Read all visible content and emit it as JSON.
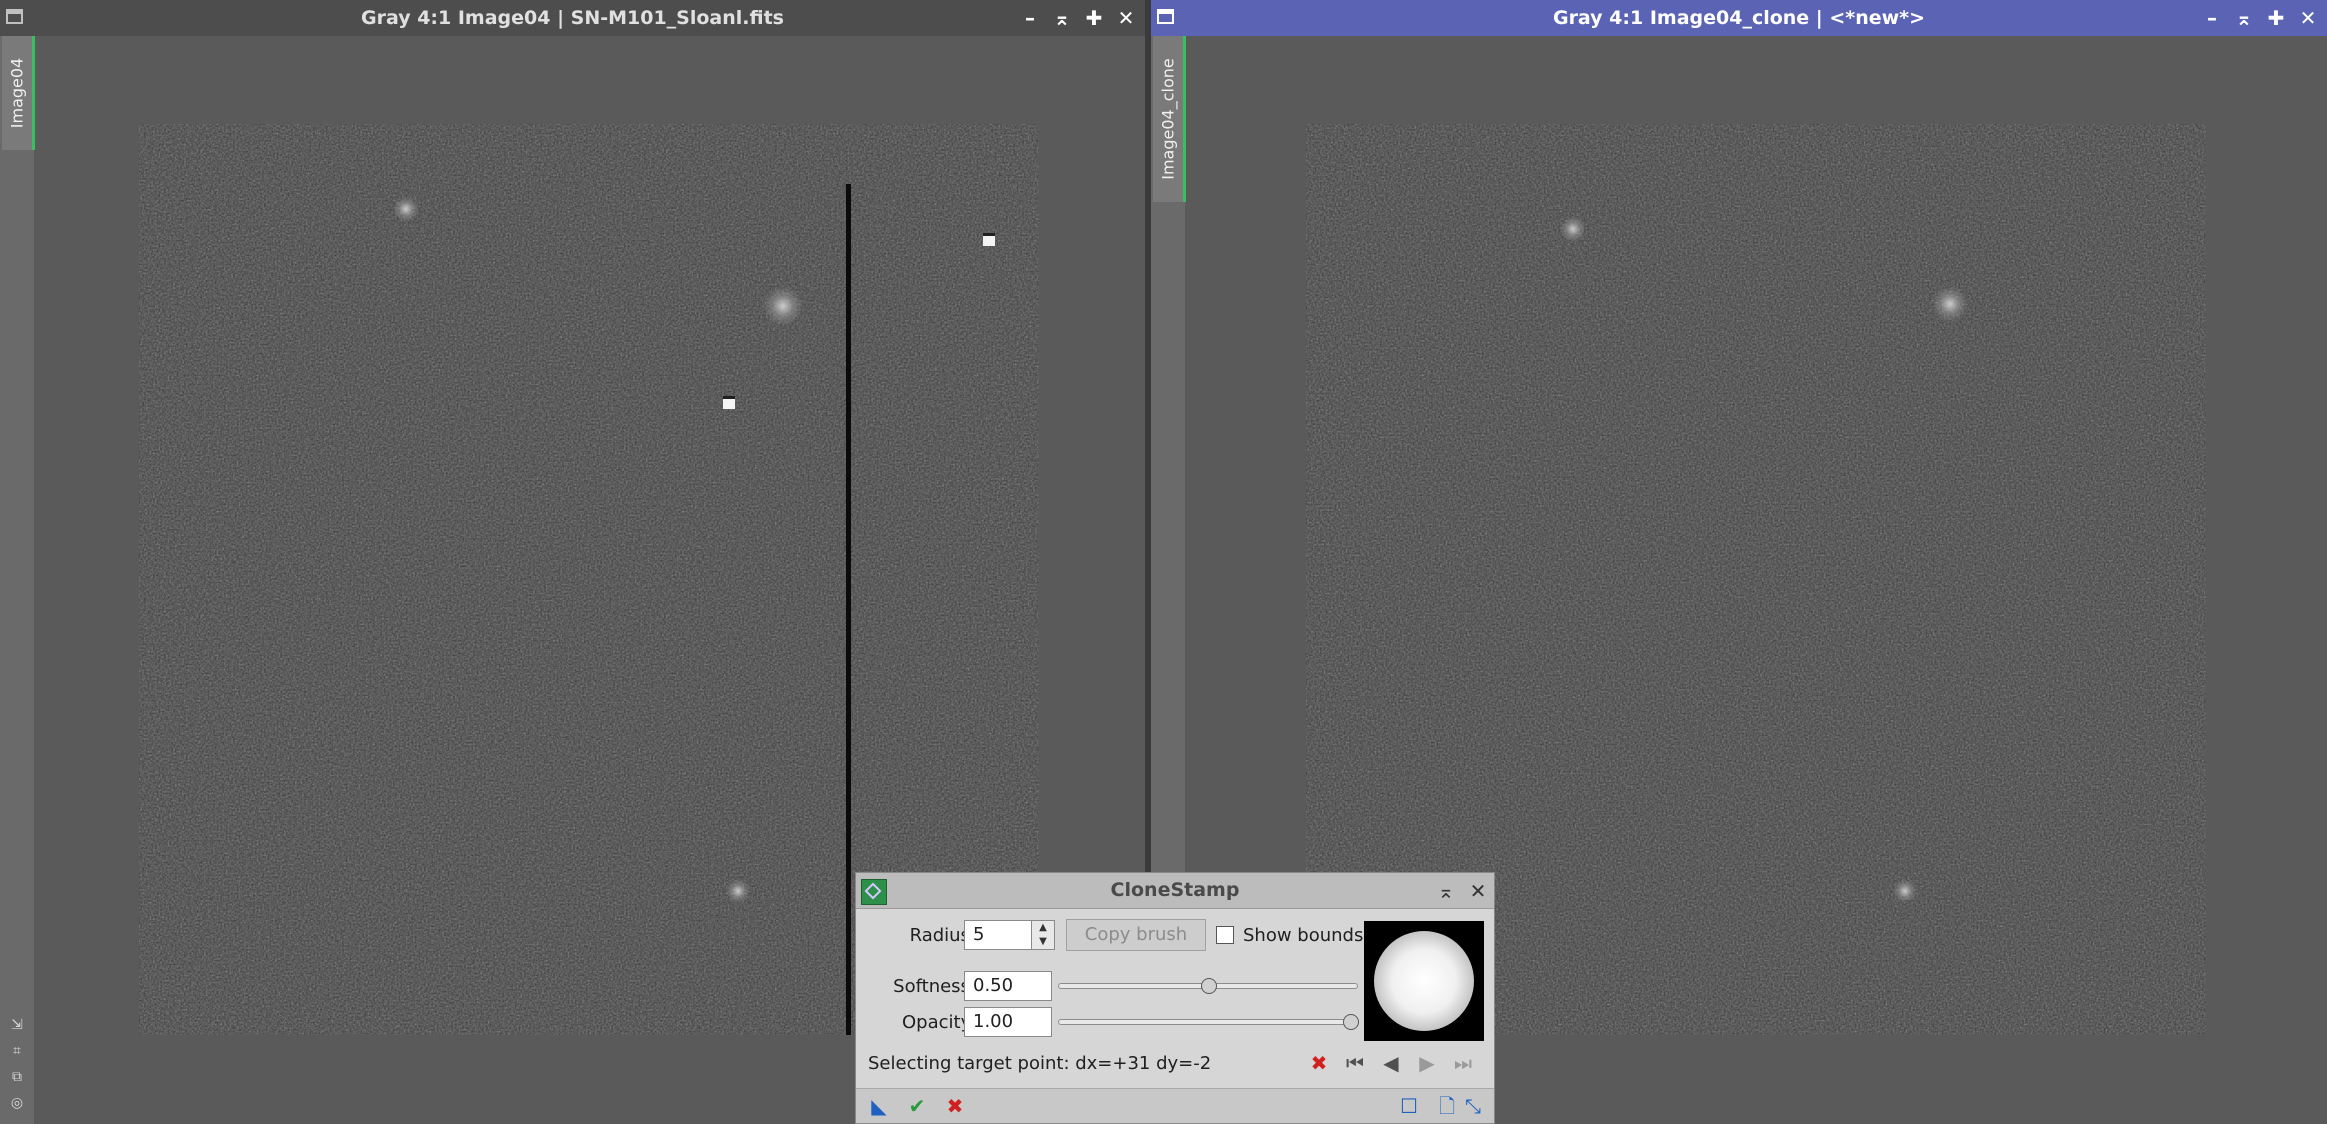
{
  "left_window": {
    "title": "Gray 4:1 Image04 | SN-M101_Sloanl.fits",
    "tab_label": "Image04",
    "buttons": [
      "minimize",
      "shade",
      "maximize",
      "close"
    ]
  },
  "right_window": {
    "title": "Gray 4:1 Image04_clone | <*new*>",
    "tab_label": "Image04_clone",
    "buttons": [
      "minimize",
      "shade",
      "maximize",
      "close"
    ]
  },
  "dialog": {
    "title": "CloneStamp",
    "radius_label": "Radius:",
    "radius_value": "5",
    "copy_brush_label": "Copy brush",
    "show_bounds_label": "Show bounds",
    "show_bounds_checked": false,
    "softness_label": "Softness:",
    "softness_value": "0.50",
    "softness": 0.5,
    "opacity_label": "Opacity:",
    "opacity_value": "1.00",
    "opacity": 1.0,
    "status": "Selecting target point: dx=+31 dy=-2"
  },
  "colors": {
    "active_title": "#5b64b4",
    "inactive_title": "#4d4d4d",
    "tab_accent": "#38c060",
    "delete_red": "#d02020",
    "apply_green": "#2a9a3a",
    "tool_blue": "#2060c0"
  },
  "icons": {
    "minimize": "minimize-icon",
    "shade": "shade-icon",
    "maximize": "maximize-icon",
    "close": "close-icon",
    "nav": [
      "delete-icon",
      "first-icon",
      "prev-icon",
      "next-icon",
      "last-icon"
    ],
    "footer": [
      "new-instance-icon",
      "apply-icon",
      "cancel-icon",
      "reset-icon",
      "doc-icon",
      "preview-icon"
    ]
  }
}
